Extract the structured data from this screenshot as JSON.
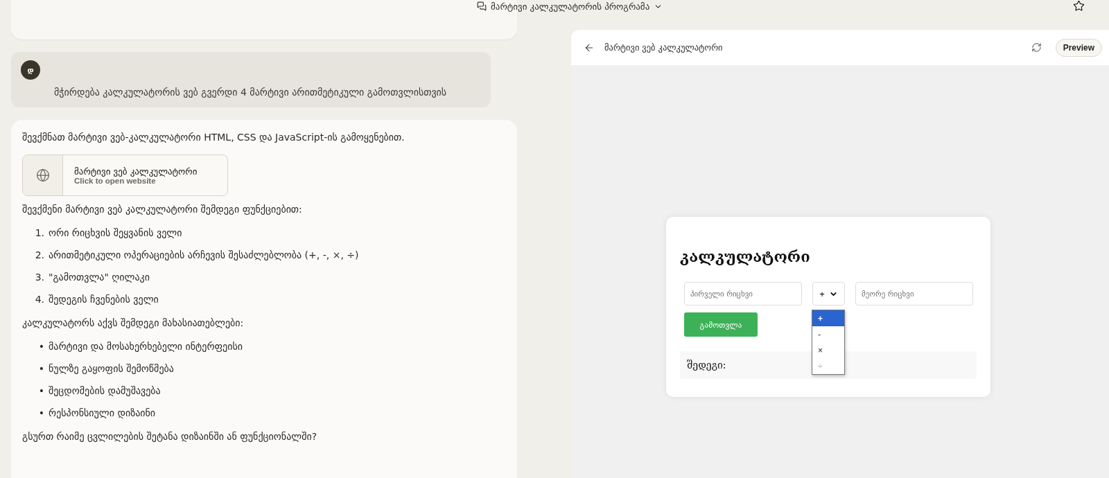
{
  "header": {
    "title": "მარტივი კალკულატორის პროგრამა"
  },
  "chat": {
    "user_message": {
      "avatar": "დ",
      "text": "მჭირდება კალკულატორის ვებ გვერდი 4 მარტივი არითმეტიკული გამოთვლისთვის"
    },
    "assistant": {
      "intro": "შევქმნათ მარტივი ვებ-კალკულატორი HTML, CSS და JavaScript-ის გამოყენებით.",
      "artifact": {
        "title": "მარტივი ვებ კალკულატორი",
        "subtitle": "Click to open website"
      },
      "features_heading": "შევქმენი მარტივი ვებ კალკულატორი შემდეგი ფუნქციებით:",
      "features": [
        {
          "number": "1.",
          "text": "ორი რიცხვის შეყვანის ველი"
        },
        {
          "number": "2.",
          "text": "არითმეტიკული ოპერაციების არჩევის შესაძლებლობა (+, -, ×, ÷)"
        },
        {
          "number": "3.",
          "text": "\"გამოთვლა\" ღილაკი"
        },
        {
          "number": "4.",
          "text": "შედეგის ჩვენების ველი"
        }
      ],
      "properties_heading": "კალკულატორს აქვს შემდეგი მახასიათებლები:",
      "properties": [
        {
          "marker": "•",
          "text": "მარტივი და მოსახერხებელი ინტერფეისი"
        },
        {
          "marker": "•",
          "text": "ნულზე გაყოფის შემოწმება"
        },
        {
          "marker": "•",
          "text": "შეცდომების დამუშავება"
        },
        {
          "marker": "•",
          "text": "რესპონსიული დიზაინი"
        }
      ],
      "question": "გსურთ რაიმე ცვლილების შეტანა დიზაინში ან ფუნქციონალში?"
    }
  },
  "preview": {
    "title": "მარტივი ვებ კალკულატორი",
    "button": "Preview",
    "calculator": {
      "heading": "კალკულატორი",
      "first_placeholder": "პირველი რიცხვი",
      "operator": "+",
      "second_placeholder": "მეორე რიცხვი",
      "button": "გამოთვლა",
      "result_label": "შედეგი:",
      "options": [
        {
          "label": "+",
          "selected": true,
          "disabled": false
        },
        {
          "label": "-",
          "selected": false,
          "disabled": false
        },
        {
          "label": "×",
          "selected": false,
          "disabled": false
        },
        {
          "label": "÷",
          "selected": false,
          "disabled": true
        }
      ]
    }
  }
}
